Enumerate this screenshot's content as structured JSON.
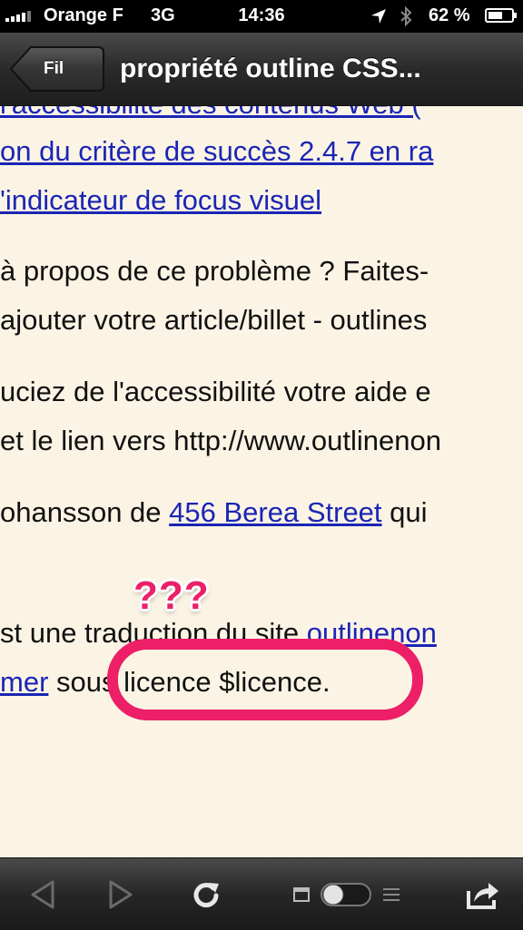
{
  "status_bar": {
    "carrier": "Orange F",
    "network": "3G",
    "time": "14:36",
    "battery_percent": "62 %",
    "battery_level": 0.62
  },
  "nav": {
    "back_label": "Fil",
    "title": "propriété outline CSS..."
  },
  "content": {
    "lines": {
      "l1": "l'accessibilité des contenus Web (",
      "l2": "on du critère de succès 2.4.7 en ra",
      "l3": "'indicateur de focus visuel",
      "p1_l1": "à propos de ce problème ? Faites-",
      "p1_l2": "ajouter votre article/billet - outlines",
      "p2_l1": "uciez de l'accessibilité votre aide e",
      "p2_l2": "et le lien vers http://www.outlinenon",
      "p3_pre": "ohansson de ",
      "p3_link": "456 Berea Street",
      "p3_post": " qui",
      "p4_pre": "st une traduction du site ",
      "p4_link": "outlinenon",
      "p5_link": "mer",
      "p5_post": " sous licence $licence."
    }
  },
  "annotation": {
    "text": "???",
    "color": "#ec1f67"
  },
  "toolbar": {
    "back_icon": "triangle-left-icon",
    "forward_icon": "triangle-right-icon",
    "reload_icon": "reload-icon",
    "reader_toggle_icon": "reader-toggle-icon",
    "share_icon": "share-icon"
  }
}
